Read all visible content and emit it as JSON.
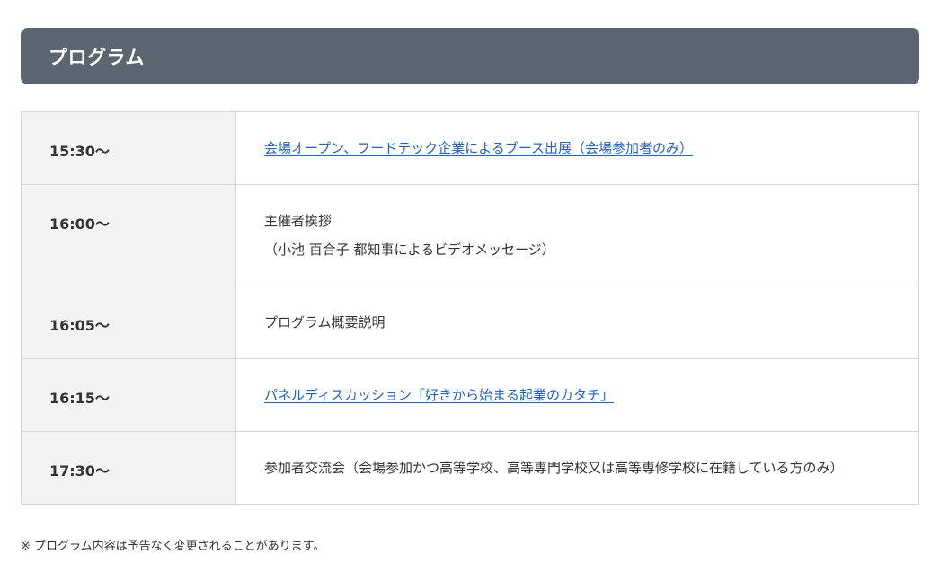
{
  "section": {
    "title": "プログラム"
  },
  "program": [
    {
      "time": "15:30～",
      "lines": [
        "会場オープン、フードテック企業によるブース出展（会場参加者のみ）"
      ],
      "link": true
    },
    {
      "time": "16:00～",
      "lines": [
        "主催者挨拶",
        "（小池 百合子 都知事によるビデオメッセージ）"
      ],
      "link": false
    },
    {
      "time": "16:05～",
      "lines": [
        "プログラム概要説明"
      ],
      "link": false
    },
    {
      "time": "16:15～",
      "lines": [
        "パネルディスカッション「好きから始まる起業のカタチ」"
      ],
      "link": true
    },
    {
      "time": "17:30～",
      "lines": [
        "参加者交流会（会場参加かつ高等学校、高等専門学校又は高等専修学校に在籍している方のみ）"
      ],
      "link": false
    }
  ],
  "footnote": "※ プログラム内容は予告なく変更されることがあります。",
  "colors": {
    "header_bg": "#5b6670",
    "time_cell_bg": "#f3f3f3",
    "link": "#2563b8",
    "border": "#d5d5d5"
  }
}
